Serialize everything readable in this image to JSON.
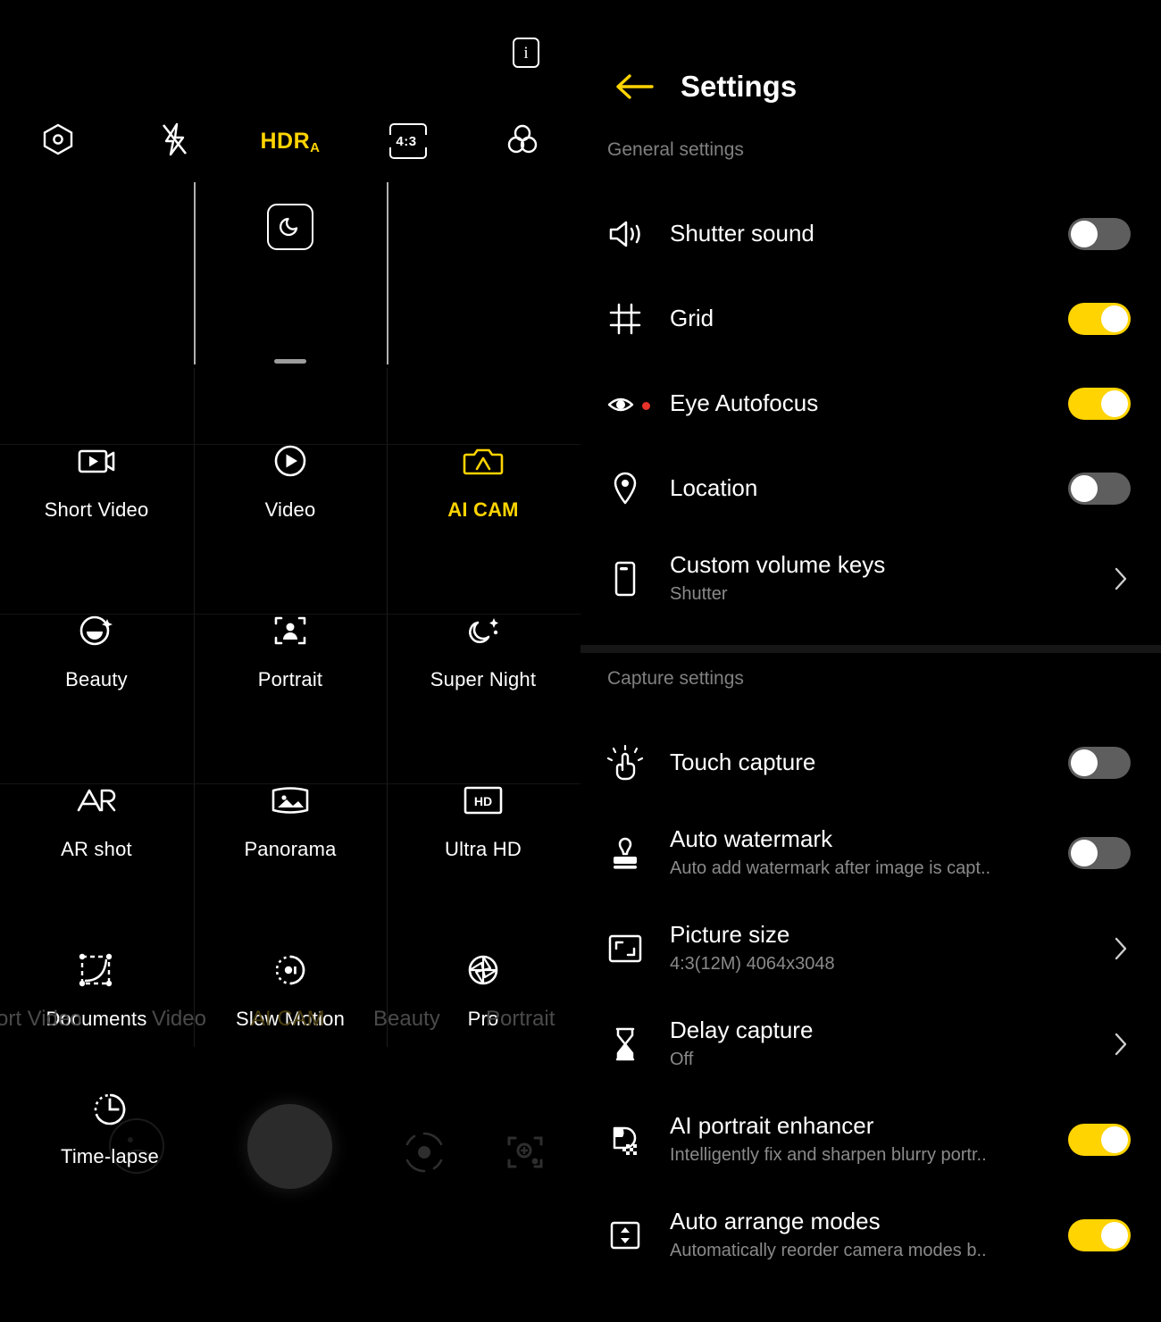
{
  "camera": {
    "info_icon": "info-icon",
    "info_glyph": "i",
    "top_controls": [
      {
        "name": "filter-aperture-icon",
        "label": ""
      },
      {
        "name": "flash-off-icon",
        "label": ""
      },
      {
        "name": "hdr-auto-label",
        "label": "HDR",
        "sublabel": "A",
        "active": true
      },
      {
        "name": "aspect-ratio-button",
        "label": "4:3"
      },
      {
        "name": "color-filter-icon",
        "label": ""
      }
    ],
    "preview": {
      "night_chip_icon": "moon-icon",
      "grid_lines_visible": true,
      "drag_handle": "drag-handle"
    },
    "modes": [
      {
        "label": "Short Video",
        "icon": "short-video-icon",
        "active": false
      },
      {
        "label": "Video",
        "icon": "video-icon",
        "active": false
      },
      {
        "label": "AI CAM",
        "icon": "ai-cam-icon",
        "active": true
      },
      {
        "label": "Beauty",
        "icon": "beauty-icon",
        "active": false
      },
      {
        "label": "Portrait",
        "icon": "portrait-icon",
        "active": false
      },
      {
        "label": "Super Night",
        "icon": "super-night-icon",
        "active": false
      },
      {
        "label": "AR shot",
        "icon": "ar-shot-icon",
        "active": false
      },
      {
        "label": "Panorama",
        "icon": "panorama-icon",
        "active": false
      },
      {
        "label": "Ultra HD",
        "icon": "ultra-hd-icon",
        "active": false
      },
      {
        "label": "Documents",
        "icon": "documents-icon",
        "active": false
      },
      {
        "label": "Slow Motion",
        "icon": "slow-motion-icon",
        "active": false
      },
      {
        "label": "Pro",
        "icon": "pro-icon",
        "active": false
      }
    ],
    "ghost_modes": [
      {
        "label": "ort Video",
        "gold": false
      },
      {
        "label": "Video",
        "gold": false
      },
      {
        "label": "AI CAM",
        "gold": true
      },
      {
        "label": "Beauty",
        "gold": false
      },
      {
        "label": "Portrait",
        "gold": false
      }
    ],
    "bottom": {
      "timelapse_label": "Time-lapse",
      "timelapse_icon": "time-lapse-icon",
      "gallery_thumb": "gallery-thumbnail",
      "shutter": "shutter-button",
      "flip_icon": "camera-flip-icon",
      "scan_icon": "ai-scan-icon"
    },
    "accent": "#FFD400",
    "grid_line_color": "#CFCFCF"
  },
  "settings": {
    "back_icon": "back-arrow-icon",
    "title": "Settings",
    "sections": [
      {
        "heading": "General settings",
        "rows": [
          {
            "title": "Shutter sound",
            "sub": "",
            "icon": "speaker-icon",
            "control": "toggle",
            "value": "off",
            "badge": false
          },
          {
            "title": "Grid",
            "sub": "",
            "icon": "grid-icon",
            "control": "toggle",
            "value": "on",
            "badge": false
          },
          {
            "title": "Eye Autofocus",
            "sub": "",
            "icon": "eye-icon",
            "control": "toggle",
            "value": "on",
            "badge": true
          },
          {
            "title": "Location",
            "sub": "",
            "icon": "location-pin-icon",
            "control": "toggle",
            "value": "off",
            "badge": false
          },
          {
            "title": "Custom volume keys",
            "sub": "Shutter",
            "icon": "phone-icon",
            "control": "chevron",
            "value": "",
            "badge": false
          }
        ]
      },
      {
        "heading": "Capture settings",
        "rows": [
          {
            "title": "Touch capture",
            "sub": "",
            "icon": "touch-hand-icon",
            "control": "toggle",
            "value": "off",
            "badge": false
          },
          {
            "title": "Auto watermark",
            "sub": "Auto add watermark after image is capt..",
            "icon": "stamp-icon",
            "control": "toggle",
            "value": "off",
            "badge": false
          },
          {
            "title": "Picture size",
            "sub": "4:3(12M) 4064x3048",
            "icon": "picture-size-icon",
            "control": "chevron",
            "value": "",
            "badge": false
          },
          {
            "title": "Delay capture",
            "sub": "Off",
            "icon": "hourglass-icon",
            "control": "chevron",
            "value": "",
            "badge": false
          },
          {
            "title": "AI portrait enhancer",
            "sub": "Intelligently fix and sharpen blurry portr..",
            "icon": "ai-enhance-icon",
            "control": "toggle",
            "value": "on",
            "badge": false
          },
          {
            "title": "Auto arrange modes",
            "sub": "Automatically reorder camera modes b..",
            "icon": "arrange-icon",
            "control": "toggle",
            "value": "on",
            "badge": false
          }
        ]
      }
    ],
    "accent": "#FFD400",
    "toggle_off_color": "#5E5E5E",
    "badge_color": "#E8322A"
  }
}
